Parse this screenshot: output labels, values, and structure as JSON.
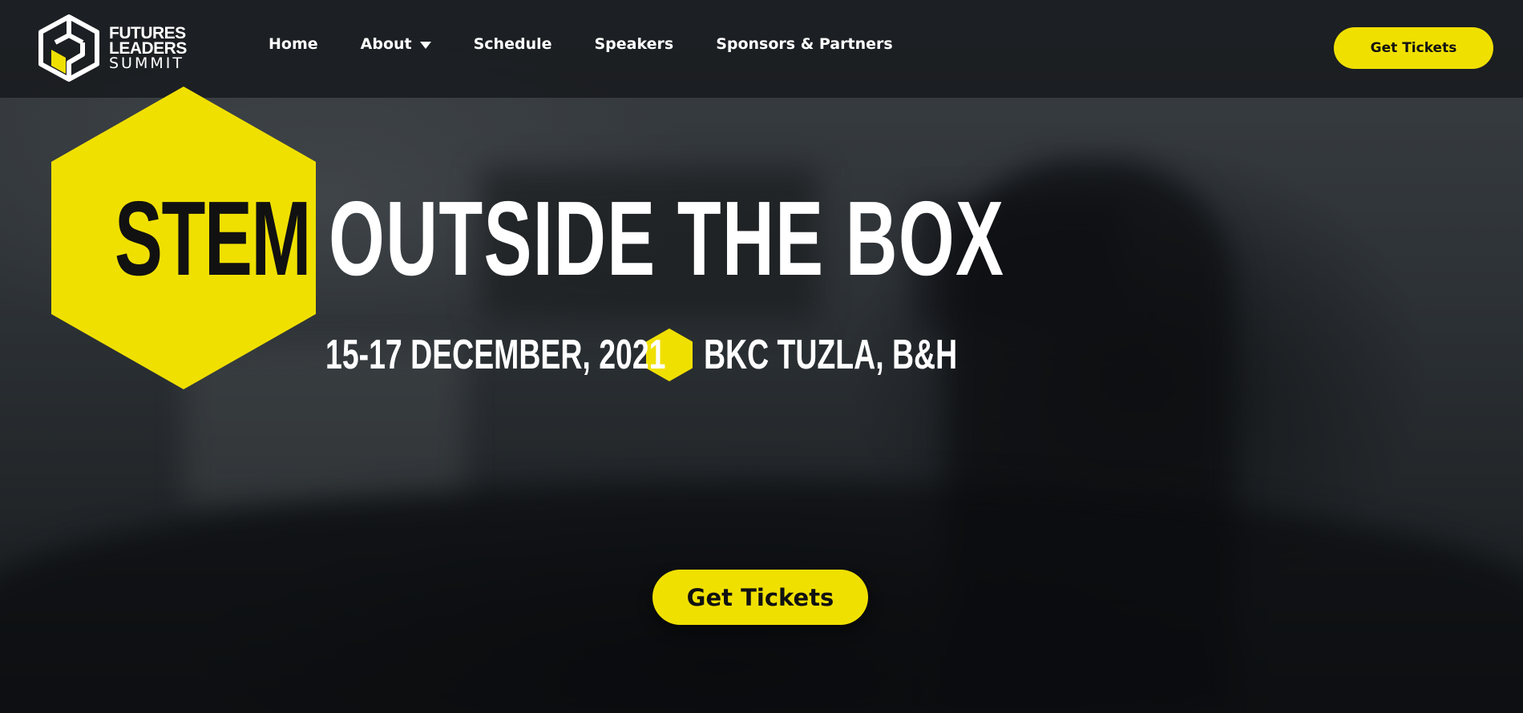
{
  "brand": {
    "line1": "FUTURES",
    "line2": "LEADERS",
    "line3": "SUMMIT",
    "logo_icon": "fls-cube-logo-icon"
  },
  "nav": {
    "items": [
      {
        "label": "Home",
        "has_dropdown": false
      },
      {
        "label": "About",
        "has_dropdown": true
      },
      {
        "label": "Schedule",
        "has_dropdown": false
      },
      {
        "label": "Speakers",
        "has_dropdown": false
      },
      {
        "label": "Sponsors & Partners",
        "has_dropdown": false
      }
    ],
    "dropdown_icon": "caret-down-icon",
    "cta_label": "Get Tickets"
  },
  "hero": {
    "title_accent": "STEM",
    "title_rest": "OUTSIDE THE BOX",
    "date": "15-17 DECEMBER, 2021",
    "separator_icon": "hexagon-icon",
    "venue": "BKC TUZLA, B&H",
    "cta_label": "Get Tickets"
  },
  "colors": {
    "accent": "#f0e000",
    "text_light": "#ffffff",
    "text_dark": "#111111",
    "nav_bg": "#16191c"
  }
}
